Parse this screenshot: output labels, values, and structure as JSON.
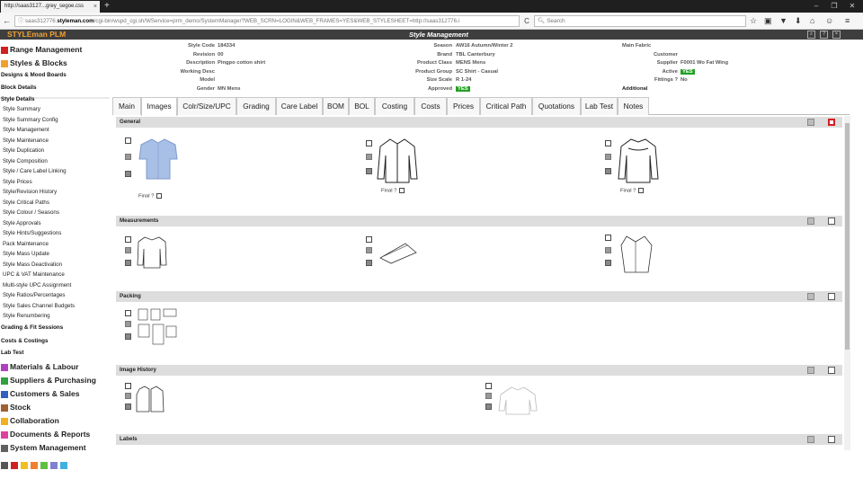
{
  "browser": {
    "tab_title": "http://saas3127...grey_segoe.css",
    "tab_close": "×",
    "new_tab": "+",
    "url_prefix": "saas312776.",
    "url_host": "styleman.com",
    "url_path": "/cgi-bin/wspd_cgi.sh/WService=prm_demo/SystemManager?WEB_SCRN=LOGIN&WEB_FRAMES=YES&WEB_STYLESHEET=http://saas312776.i",
    "search_placeholder": "Search",
    "back": "←",
    "info": "ⓘ",
    "reload": "C",
    "window_min": "–",
    "window_max": "❐",
    "window_close": "✕",
    "toolbar_icons": [
      "☆",
      "▣",
      "▼",
      "⬇",
      "⌂",
      "☺",
      "≡"
    ]
  },
  "app": {
    "brand": "STYLEman PLM",
    "section_title": "Style Management",
    "header_icons": [
      "search-icon",
      "help-icon",
      "close-icon"
    ]
  },
  "sidebar": {
    "major": [
      {
        "label": "Range Management",
        "color": "#d02020"
      },
      {
        "label": "Styles & Blocks",
        "color": "#f0a030"
      },
      {
        "label": "Materials & Labour",
        "color": "#b040c0"
      },
      {
        "label": "Suppliers & Purchasing",
        "color": "#30a040"
      },
      {
        "label": "Customers & Sales",
        "color": "#3060c0"
      },
      {
        "label": "Stock",
        "color": "#a06030"
      },
      {
        "label": "Collaboration",
        "color": "#f0b020"
      },
      {
        "label": "Documents & Reports",
        "color": "#e040a0"
      },
      {
        "label": "System Management",
        "color": "#606060"
      }
    ],
    "sub": {
      "designs": "Designs & Mood Boards",
      "block_details": "Block Details",
      "style_details": "Style Details",
      "grading": "Grading & Fit Sessions",
      "costs": "Costs & Costings",
      "lab_test": "Lab Test"
    },
    "items": [
      "Style Summary",
      "Style Summary Config",
      "Style Management",
      "Style Maintenance",
      "Style Duplication",
      "Style Composition",
      "Style / Care Label Linking",
      "Style Prices",
      "Style/Revision History",
      "Style Critical Paths",
      "Style Colour / Seasons",
      "Style Approvals",
      "Style Hints/Suggestions",
      "Pack Maintenance",
      "Style Mass Update",
      "Style Mass Deactivation",
      "UPC & VAT Maintenance",
      "Multi-style UPC Assignment",
      "Style Ratios/Percentages",
      "Style Sales Channel Budgets",
      "Style Renumbering"
    ],
    "quick_colors": [
      "#d02020",
      "#f060b0",
      "#f0c020",
      "#60c040",
      "#30a0e0",
      "#8080d0",
      "#40b0e0"
    ]
  },
  "style_info": {
    "col1": [
      {
        "label": "Style Code",
        "value": "184334"
      },
      {
        "label": "Revision",
        "value": "00"
      },
      {
        "label": "Description",
        "value": "Pingpo cotton shirt"
      },
      {
        "label": "Working Desc",
        "value": ""
      },
      {
        "label": "Model",
        "value": ""
      },
      {
        "label": "Gender",
        "value": "MN Mens"
      }
    ],
    "col2": [
      {
        "label": "Season",
        "value": "AW16 Autumn/Winter 2"
      },
      {
        "label": "Brand",
        "value": "TBL Canterbury"
      },
      {
        "label": "Product Class",
        "value": "MENS Mens"
      },
      {
        "label": "Product Group",
        "value": "SC Shirt - Casual"
      },
      {
        "label": "Size Scale",
        "value": "R 1-24"
      },
      {
        "label": "Approved",
        "value": "YES"
      }
    ],
    "col3": [
      {
        "label": "Main Fabric",
        "value": ""
      },
      {
        "label": "Customer",
        "value": ""
      },
      {
        "label": "Supplier",
        "value": "F0001 Wo Fat Wing"
      },
      {
        "label": "Active",
        "value": "YES"
      },
      {
        "label": "Fittings ?",
        "value": "No"
      },
      {
        "label": "Additional",
        "value": ""
      }
    ]
  },
  "tabs": [
    "Main",
    "Images",
    "Colr/Size/UPC",
    "Grading",
    "Care Label",
    "BOM",
    "BOL",
    "Costing",
    "Costs",
    "Prices",
    "Critical Path",
    "Quotations",
    "Lab Test",
    "Notes"
  ],
  "active_tab": "Images",
  "panels": {
    "general": "General",
    "measurements": "Measurements",
    "packing": "Packing",
    "image_history": "Image History",
    "labels": "Labels"
  },
  "final_label": "Final ?"
}
